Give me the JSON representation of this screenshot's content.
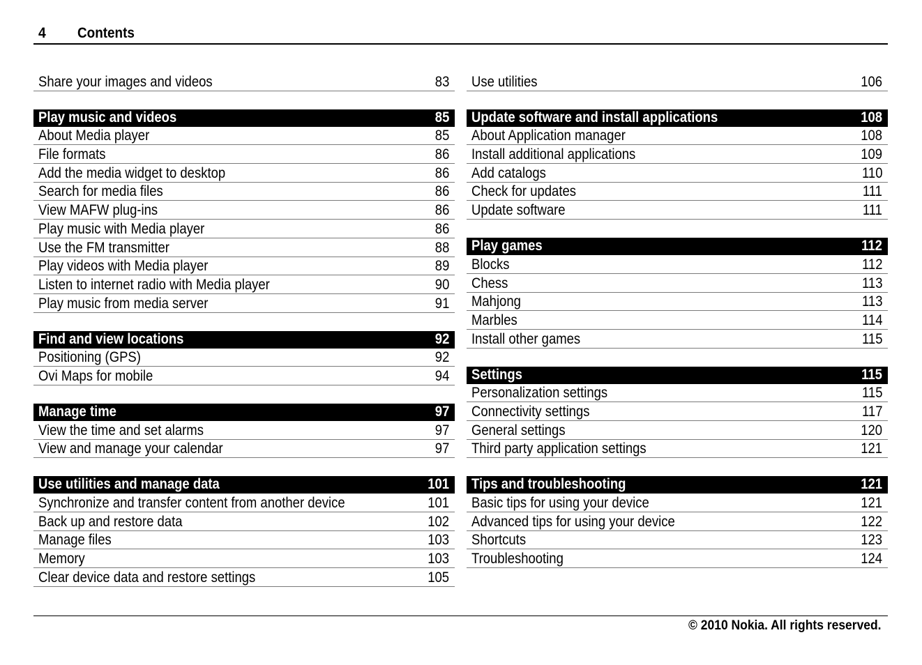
{
  "page": {
    "number": "4",
    "title": "Contents",
    "footer": "© 2010 Nokia. All rights reserved."
  },
  "left_column": {
    "lead": [
      {
        "title": "Share your images and videos",
        "page": "83"
      }
    ],
    "sections": [
      {
        "title": "Play music and videos",
        "page": "85",
        "items": [
          {
            "title": "About Media player",
            "page": "85"
          },
          {
            "title": "File formats",
            "page": "86"
          },
          {
            "title": "Add the media widget to desktop",
            "page": "86"
          },
          {
            "title": "Search for media files",
            "page": "86"
          },
          {
            "title": "View MAFW plug-ins",
            "page": "86"
          },
          {
            "title": "Play music with Media player",
            "page": "86"
          },
          {
            "title": "Use the FM transmitter",
            "page": "88"
          },
          {
            "title": "Play videos with Media player",
            "page": "89"
          },
          {
            "title": "Listen to internet radio with Media player",
            "page": "90"
          },
          {
            "title": "Play music from media server",
            "page": "91"
          }
        ]
      },
      {
        "title": "Find and view locations",
        "page": "92",
        "items": [
          {
            "title": "Positioning (GPS)",
            "page": "92"
          },
          {
            "title": "Ovi Maps for mobile",
            "page": "94"
          }
        ]
      },
      {
        "title": "Manage time",
        "page": "97",
        "items": [
          {
            "title": "View the time and set alarms",
            "page": "97"
          },
          {
            "title": "View and manage your calendar",
            "page": "97"
          }
        ]
      },
      {
        "title": "Use utilities and manage data",
        "page": "101",
        "items": [
          {
            "title": "Synchronize and transfer content from another device",
            "page": "101"
          },
          {
            "title": "Back up and restore data",
            "page": "102"
          },
          {
            "title": "Manage files",
            "page": "103"
          },
          {
            "title": "Memory",
            "page": "103"
          },
          {
            "title": "Clear device data and restore settings",
            "page": "105"
          }
        ]
      }
    ]
  },
  "right_column": {
    "lead": [
      {
        "title": "Use utilities",
        "page": "106"
      }
    ],
    "sections": [
      {
        "title": "Update software and install applications",
        "page": "108",
        "items": [
          {
            "title": "About Application manager",
            "page": "108"
          },
          {
            "title": "Install additional applications",
            "page": "109"
          },
          {
            "title": "Add catalogs",
            "page": "110"
          },
          {
            "title": "Check for updates",
            "page": "111"
          },
          {
            "title": "Update software",
            "page": "111"
          }
        ]
      },
      {
        "title": "Play games",
        "page": "112",
        "items": [
          {
            "title": "Blocks",
            "page": "112"
          },
          {
            "title": "Chess",
            "page": "113"
          },
          {
            "title": "Mahjong",
            "page": "113"
          },
          {
            "title": "Marbles",
            "page": "114"
          },
          {
            "title": "Install other games",
            "page": "115"
          }
        ]
      },
      {
        "title": "Settings",
        "page": "115",
        "items": [
          {
            "title": "Personalization settings",
            "page": "115"
          },
          {
            "title": "Connectivity settings",
            "page": "117"
          },
          {
            "title": "General settings",
            "page": "120"
          },
          {
            "title": "Third party application settings",
            "page": "121"
          }
        ]
      },
      {
        "title": "Tips and troubleshooting",
        "page": "121",
        "items": [
          {
            "title": "Basic tips for using your device",
            "page": "121"
          },
          {
            "title": "Advanced tips for using your device",
            "page": "122"
          },
          {
            "title": "Shortcuts",
            "page": "123"
          },
          {
            "title": "Troubleshooting",
            "page": "124"
          }
        ]
      }
    ]
  }
}
